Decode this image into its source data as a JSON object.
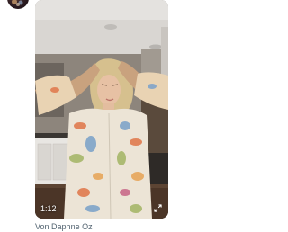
{
  "colors": {
    "caption_text": "#536471",
    "overlay_text": "#ffffff",
    "page_background": "#ffffff"
  },
  "avatar": {
    "icon": "profile-avatar"
  },
  "video": {
    "elapsed_time": "1:12",
    "expand_icon": "expand-arrows-icon"
  },
  "post": {
    "byline_prefix": "Von",
    "author_name": "Daphne Oz"
  }
}
